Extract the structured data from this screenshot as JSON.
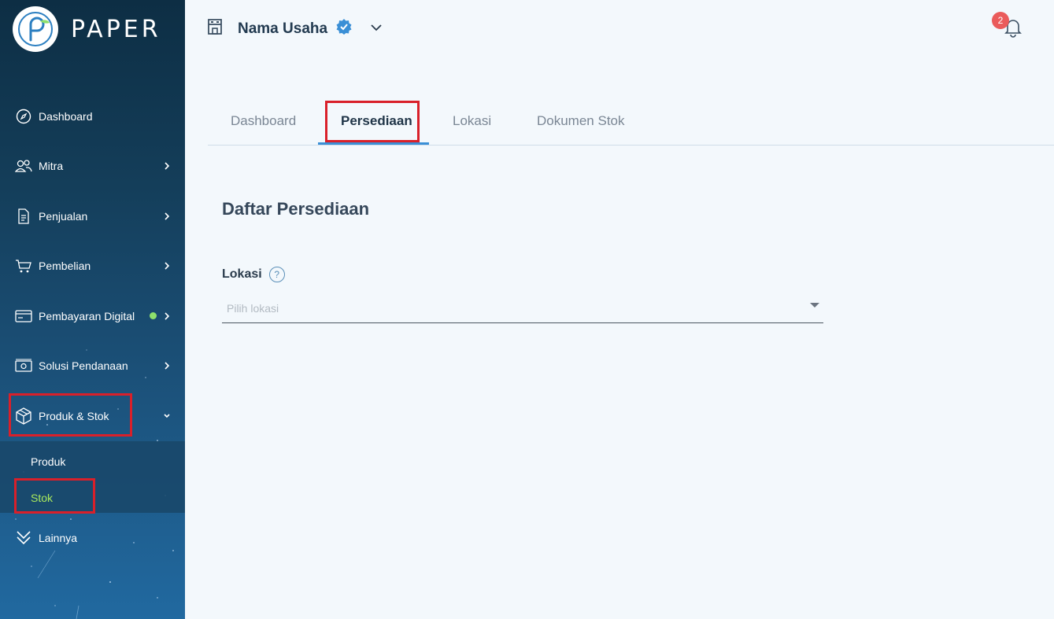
{
  "brand": {
    "name": "PAPER"
  },
  "sidebar": {
    "items": [
      {
        "label": "Dashboard",
        "icon": "compass-icon"
      },
      {
        "label": "Mitra",
        "icon": "users-icon"
      },
      {
        "label": "Penjualan",
        "icon": "document-icon"
      },
      {
        "label": "Pembelian",
        "icon": "cart-icon"
      },
      {
        "label": "Pembayaran Digital",
        "icon": "credit-card-icon"
      },
      {
        "label": "Solusi Pendanaan",
        "icon": "cash-icon"
      },
      {
        "label": "Produk & Stok",
        "icon": "box-icon"
      },
      {
        "label": "Lainnya",
        "icon": "double-chevron-down-icon"
      }
    ],
    "submenu": [
      {
        "label": "Produk"
      },
      {
        "label": "Stok"
      }
    ]
  },
  "header": {
    "store_name": "Nama Usaha",
    "notification_count": "2"
  },
  "tabs": [
    {
      "label": "Dashboard"
    },
    {
      "label": "Persediaan"
    },
    {
      "label": "Lokasi"
    },
    {
      "label": "Dokumen Stok"
    }
  ],
  "main": {
    "title": "Daftar Persediaan",
    "location_label": "Lokasi",
    "help_glyph": "?",
    "location_placeholder": "Pilih lokasi"
  },
  "colors": {
    "accent": "#3a8fd6",
    "active_submenu": "#a8e85c",
    "highlight": "#d9202a",
    "badge": "#ea5b5b",
    "status_dot": "#8ee06c"
  }
}
